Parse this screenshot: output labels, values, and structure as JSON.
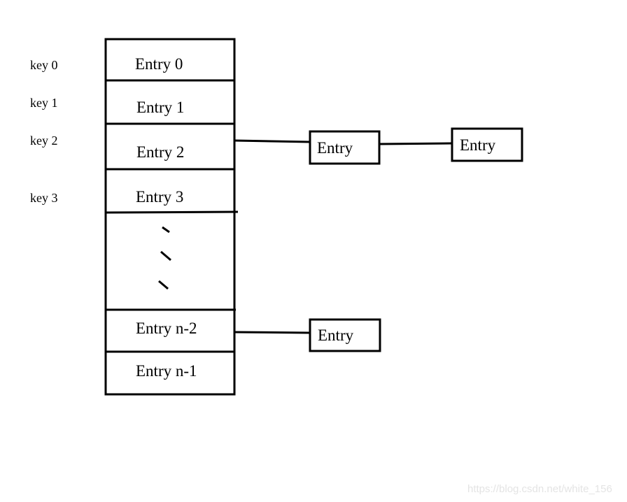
{
  "keys": [
    "key 0",
    "key 1",
    "key 2",
    "key 3"
  ],
  "table_entries": [
    "Entry 0",
    "Entry 1",
    "Entry 2",
    "Entry 3",
    "Entry n-2",
    "Entry n-1"
  ],
  "chain_nodes": {
    "bucket2_node1": "Entry",
    "bucket2_node2": "Entry",
    "bucket_n2_node1": "Entry"
  },
  "watermark": "https://blog.csdn.net/white_156"
}
